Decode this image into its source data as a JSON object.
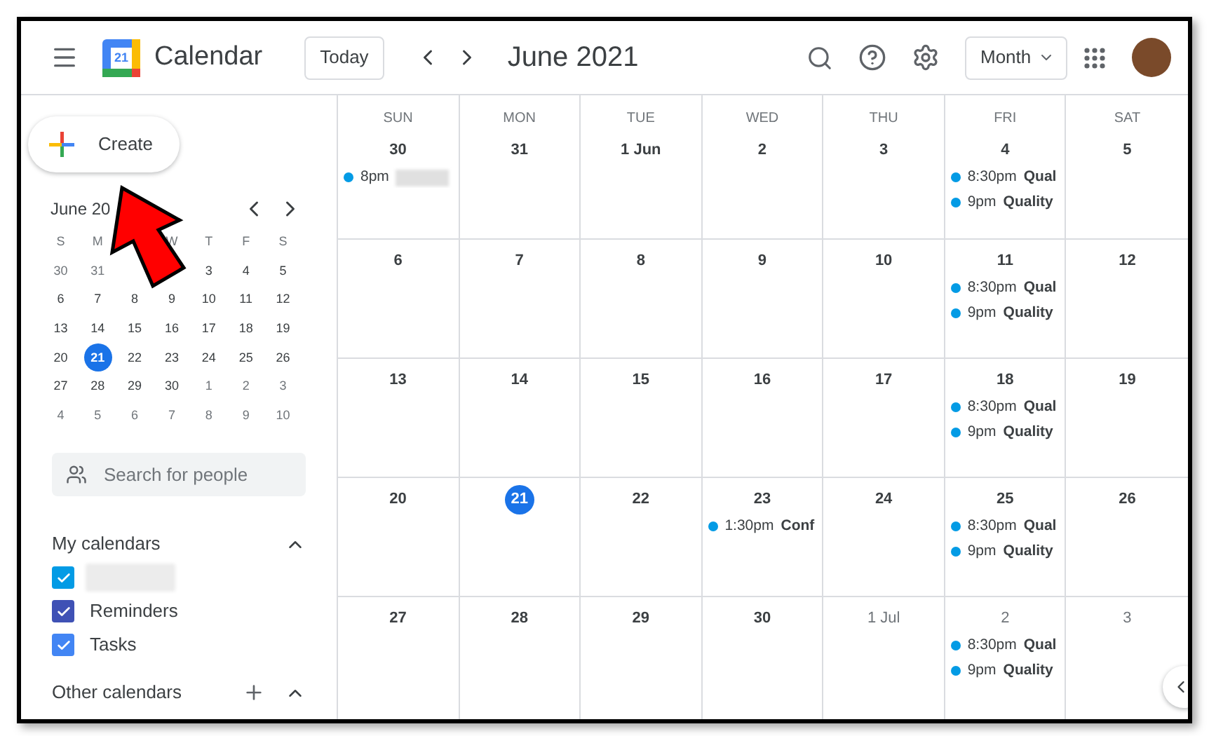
{
  "header": {
    "app_name": "Calendar",
    "logo_day": "21",
    "today_button": "Today",
    "period": "June 2021",
    "view": "Month"
  },
  "sidebar": {
    "create": "Create",
    "mini_calendar": {
      "title": "June 20",
      "weekdays": [
        {
          "label": "S"
        },
        {
          "label": "M"
        },
        {
          "covered": true
        },
        {
          "label": "W"
        },
        {
          "label": "T"
        },
        {
          "label": "F"
        },
        {
          "label": "S"
        }
      ],
      "weeks": [
        [
          {
            "label": "30",
            "muted": true,
            "selected": false,
            "covered": false
          },
          {
            "label": "31",
            "muted": true,
            "selected": false,
            "covered": false
          },
          {
            "covered": true
          },
          {
            "covered": true
          },
          {
            "label": "3",
            "muted": false,
            "selected": false,
            "covered": false
          },
          {
            "label": "4",
            "muted": false,
            "selected": false,
            "covered": false
          },
          {
            "label": "5",
            "muted": false,
            "selected": false,
            "covered": false
          }
        ],
        [
          {
            "label": "6",
            "muted": false,
            "selected": false,
            "covered": false
          },
          {
            "label": "7",
            "muted": false,
            "selected": false,
            "covered": false
          },
          {
            "label": "8",
            "muted": false,
            "selected": false,
            "covered": false
          },
          {
            "label": "9",
            "muted": false,
            "selected": false,
            "covered": false
          },
          {
            "label": "10",
            "muted": false,
            "selected": false,
            "covered": false
          },
          {
            "label": "11",
            "muted": false,
            "selected": false,
            "covered": false
          },
          {
            "label": "12",
            "muted": false,
            "selected": false,
            "covered": false
          }
        ],
        [
          {
            "label": "13",
            "muted": false,
            "selected": false,
            "covered": false
          },
          {
            "label": "14",
            "muted": false,
            "selected": false,
            "covered": false
          },
          {
            "label": "15",
            "muted": false,
            "selected": false,
            "covered": false
          },
          {
            "label": "16",
            "muted": false,
            "selected": false,
            "covered": false
          },
          {
            "label": "17",
            "muted": false,
            "selected": false,
            "covered": false
          },
          {
            "label": "18",
            "muted": false,
            "selected": false,
            "covered": false
          },
          {
            "label": "19",
            "muted": false,
            "selected": false,
            "covered": false
          }
        ],
        [
          {
            "label": "20",
            "muted": false,
            "selected": false,
            "covered": false
          },
          {
            "label": "21",
            "muted": false,
            "selected": true,
            "covered": false
          },
          {
            "label": "22",
            "muted": false,
            "selected": false,
            "covered": false
          },
          {
            "label": "23",
            "muted": false,
            "selected": false,
            "covered": false
          },
          {
            "label": "24",
            "muted": false,
            "selected": false,
            "covered": false
          },
          {
            "label": "25",
            "muted": false,
            "selected": false,
            "covered": false
          },
          {
            "label": "26",
            "muted": false,
            "selected": false,
            "covered": false
          }
        ],
        [
          {
            "label": "27",
            "muted": false,
            "selected": false,
            "covered": false
          },
          {
            "label": "28",
            "muted": false,
            "selected": false,
            "covered": false
          },
          {
            "label": "29",
            "muted": false,
            "selected": false,
            "covered": false
          },
          {
            "label": "30",
            "muted": false,
            "selected": false,
            "covered": false
          },
          {
            "label": "1",
            "muted": true,
            "selected": false,
            "covered": false
          },
          {
            "label": "2",
            "muted": true,
            "selected": false,
            "covered": false
          },
          {
            "label": "3",
            "muted": true,
            "selected": false,
            "covered": false
          }
        ],
        [
          {
            "label": "4",
            "muted": true,
            "selected": false,
            "covered": false
          },
          {
            "label": "5",
            "muted": true,
            "selected": false,
            "covered": false
          },
          {
            "label": "6",
            "muted": true,
            "selected": false,
            "covered": false
          },
          {
            "label": "7",
            "muted": true,
            "selected": false,
            "covered": false
          },
          {
            "label": "8",
            "muted": true,
            "selected": false,
            "covered": false
          },
          {
            "label": "9",
            "muted": true,
            "selected": false,
            "covered": false
          },
          {
            "label": "10",
            "muted": true,
            "selected": false,
            "covered": false
          }
        ]
      ]
    },
    "people_search": {
      "placeholder": "Search for people"
    },
    "my_calendars": {
      "title": "My calendars",
      "expanded": true,
      "items": [
        {
          "redacted": true,
          "checked": true,
          "color": "#039be5"
        },
        {
          "label": "Reminders",
          "redacted": false,
          "checked": true,
          "color": "#3f51b5"
        },
        {
          "label": "Tasks",
          "redacted": false,
          "checked": true,
          "color": "#4285f4"
        }
      ]
    },
    "other_calendars": {
      "title": "Other calendars",
      "expanded": true
    }
  },
  "grid": {
    "weekdays": [
      "SUN",
      "MON",
      "TUE",
      "WED",
      "THU",
      "FRI",
      "SAT"
    ],
    "weeks": [
      [
        {
          "label": "30",
          "muted": false,
          "selected": false,
          "events": [
            {
              "time": "8pm",
              "redacted": true
            }
          ]
        },
        {
          "label": "31",
          "muted": false,
          "selected": false
        },
        {
          "label": "1 Jun",
          "muted": false,
          "selected": false
        },
        {
          "label": "2",
          "muted": false,
          "selected": false
        },
        {
          "label": "3",
          "muted": false,
          "selected": false
        },
        {
          "label": "4",
          "muted": false,
          "selected": false,
          "events": [
            {
              "time": "8:30pm",
              "title": "Qual",
              "redacted": false
            },
            {
              "time": "9pm",
              "title": "Quality",
              "redacted": false
            }
          ]
        },
        {
          "label": "5",
          "muted": false,
          "selected": false
        }
      ],
      [
        {
          "label": "6",
          "muted": false,
          "selected": false
        },
        {
          "label": "7",
          "muted": false,
          "selected": false
        },
        {
          "label": "8",
          "muted": false,
          "selected": false
        },
        {
          "label": "9",
          "muted": false,
          "selected": false
        },
        {
          "label": "10",
          "muted": false,
          "selected": false
        },
        {
          "label": "11",
          "muted": false,
          "selected": false,
          "events": [
            {
              "time": "8:30pm",
              "title": "Qual",
              "redacted": false
            },
            {
              "time": "9pm",
              "title": "Quality",
              "redacted": false
            }
          ]
        },
        {
          "label": "12",
          "muted": false,
          "selected": false
        }
      ],
      [
        {
          "label": "13",
          "muted": false,
          "selected": false
        },
        {
          "label": "14",
          "muted": false,
          "selected": false
        },
        {
          "label": "15",
          "muted": false,
          "selected": false
        },
        {
          "label": "16",
          "muted": false,
          "selected": false
        },
        {
          "label": "17",
          "muted": false,
          "selected": false
        },
        {
          "label": "18",
          "muted": false,
          "selected": false,
          "events": [
            {
              "time": "8:30pm",
              "title": "Qual",
              "redacted": false
            },
            {
              "time": "9pm",
              "title": "Quality",
              "redacted": false
            }
          ]
        },
        {
          "label": "19",
          "muted": false,
          "selected": false
        }
      ],
      [
        {
          "label": "20",
          "muted": false,
          "selected": false
        },
        {
          "label": "21",
          "muted": false,
          "selected": true
        },
        {
          "label": "22",
          "muted": false,
          "selected": false
        },
        {
          "label": "23",
          "muted": false,
          "selected": false,
          "events": [
            {
              "time": "1:30pm",
              "title": "Conf",
              "redacted": false
            }
          ]
        },
        {
          "label": "24",
          "muted": false,
          "selected": false
        },
        {
          "label": "25",
          "muted": false,
          "selected": false,
          "events": [
            {
              "time": "8:30pm",
              "title": "Qual",
              "redacted": false
            },
            {
              "time": "9pm",
              "title": "Quality",
              "redacted": false
            }
          ]
        },
        {
          "label": "26",
          "muted": false,
          "selected": false
        }
      ],
      [
        {
          "label": "27",
          "muted": false,
          "selected": false
        },
        {
          "label": "28",
          "muted": false,
          "selected": false
        },
        {
          "label": "29",
          "muted": false,
          "selected": false
        },
        {
          "label": "30",
          "muted": false,
          "selected": false
        },
        {
          "label": "1 Jul",
          "muted": true,
          "selected": false
        },
        {
          "label": "2",
          "muted": true,
          "selected": false,
          "events": [
            {
              "time": "8:30pm",
              "title": "Qual",
              "redacted": false
            },
            {
              "time": "9pm",
              "title": "Quality",
              "redacted": false
            }
          ]
        },
        {
          "label": "3",
          "muted": true,
          "selected": false
        }
      ]
    ]
  }
}
